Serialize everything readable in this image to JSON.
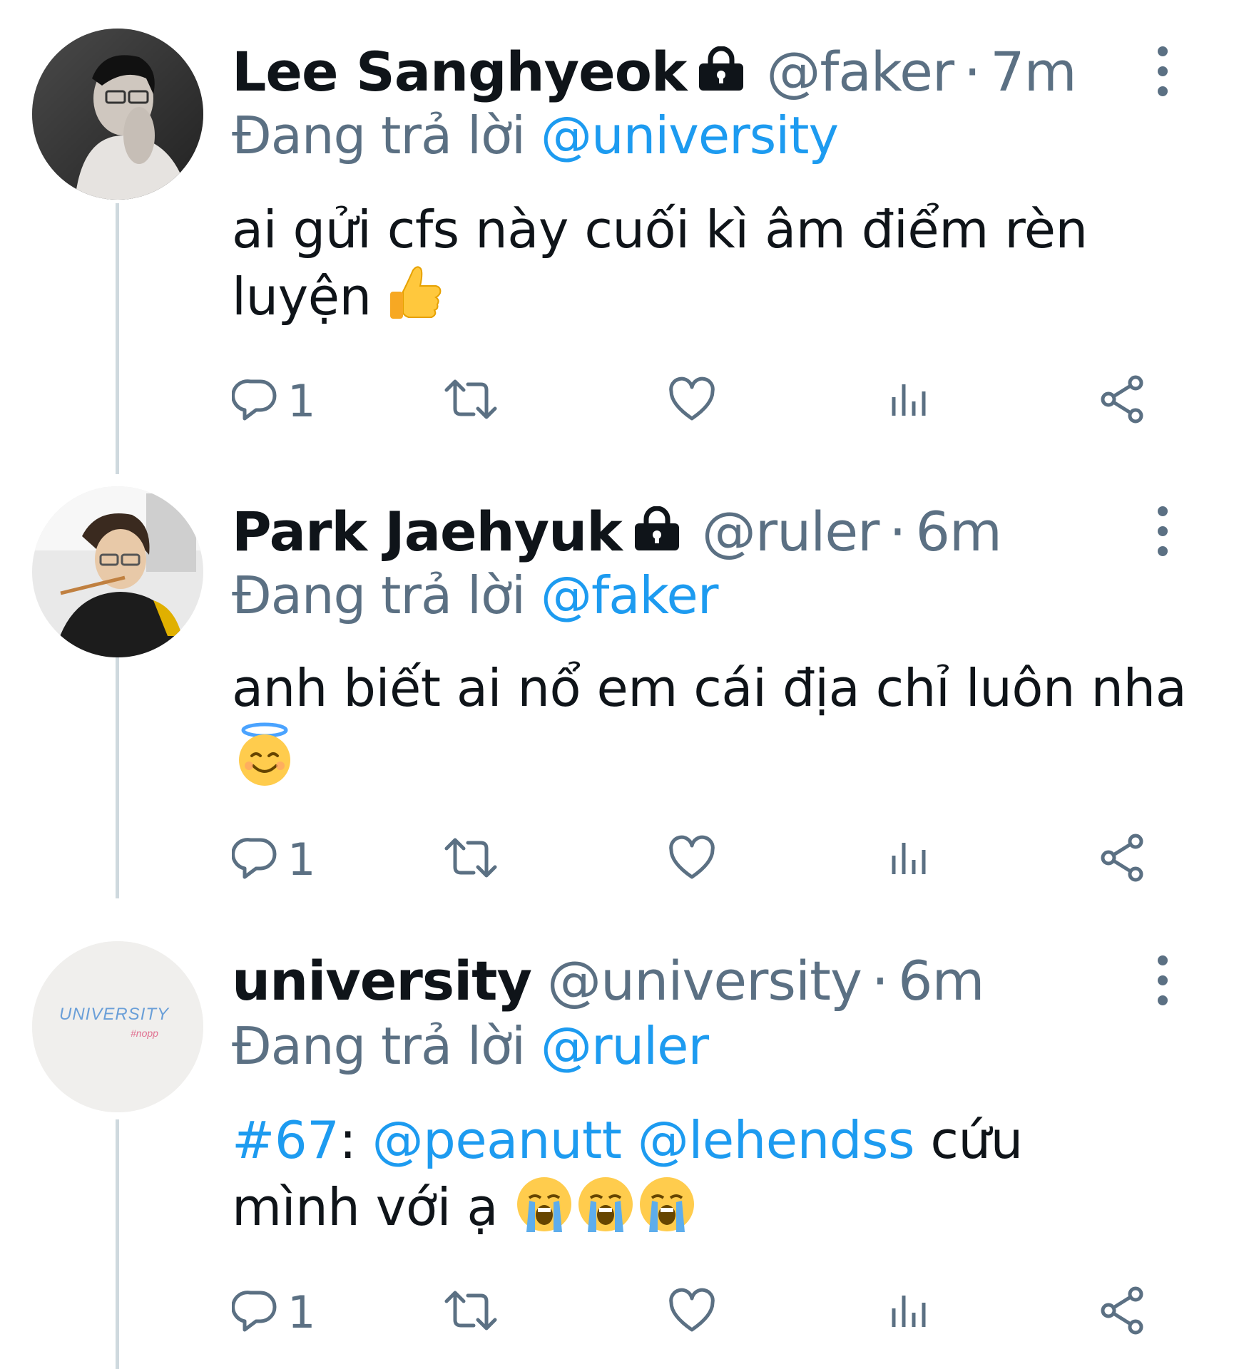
{
  "tweets": [
    {
      "name": "Lee Sanghyeok",
      "handle": "@faker",
      "time": "7m",
      "reply_prefix": "Đang trả lời",
      "reply_to": "@university",
      "text": "ai gửi cfs này cuối kì âm điểm rèn luyện",
      "emoji": [
        "thumbs-up"
      ],
      "reply_count": "1",
      "protected": true
    },
    {
      "name": "Park Jaehyuk",
      "handle": "@ruler",
      "time": "6m",
      "reply_prefix": "Đang trả lời",
      "reply_to": "@faker",
      "text": "anh biết ai nổ em cái địa chỉ luôn nha",
      "emoji": [
        "smiling-face-with-halo"
      ],
      "reply_count": "1",
      "protected": true
    },
    {
      "name": "university",
      "handle": "@university",
      "time": "6m",
      "reply_prefix": "Đang trả lời",
      "reply_to": "@ruler",
      "text_parts": {
        "hashtag": "#67",
        "colon": ":",
        "mention1": "@peanutt",
        "mention2": "@lehendss",
        "line1_rest": "cứu",
        "line2": "mình với ạ"
      },
      "emoji": [
        "loudly-crying-face",
        "loudly-crying-face",
        "loudly-crying-face"
      ],
      "reply_count": "1",
      "protected": false,
      "avatar_text": "UNIVERSITY",
      "avatar_subtext": "#nopp"
    }
  ],
  "separator": "·",
  "colors": {
    "text": "#0f1419",
    "secondary": "#5b7083",
    "accent": "#1d9bf0",
    "thread_line": "#cfd9de"
  }
}
